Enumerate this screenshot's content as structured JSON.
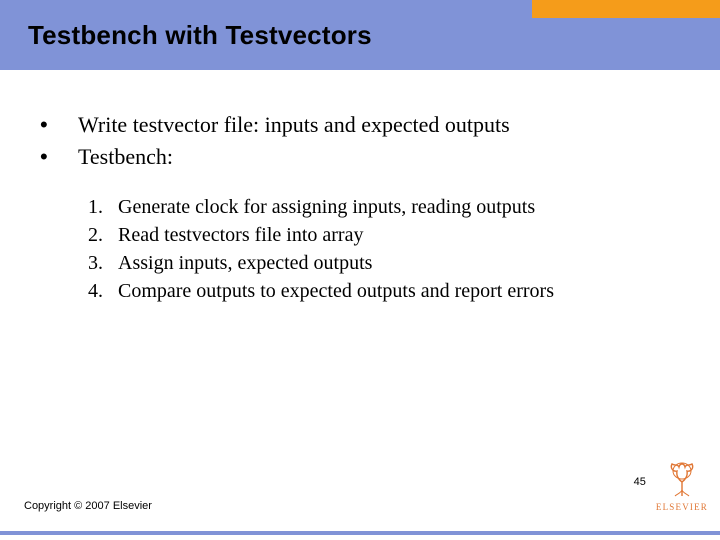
{
  "header": {
    "title": "Testbench with Testvectors"
  },
  "bullets": [
    "Write testvector file: inputs and expected outputs",
    "Testbench:"
  ],
  "numbered": [
    "Generate clock for assigning inputs, reading outputs",
    "Read testvectors file into array",
    "Assign inputs, expected outputs",
    "Compare outputs to expected outputs and report errors"
  ],
  "footer": {
    "copyright": "Copyright © 2007 Elsevier",
    "page": "45",
    "logo_text": "ELSEVIER"
  }
}
